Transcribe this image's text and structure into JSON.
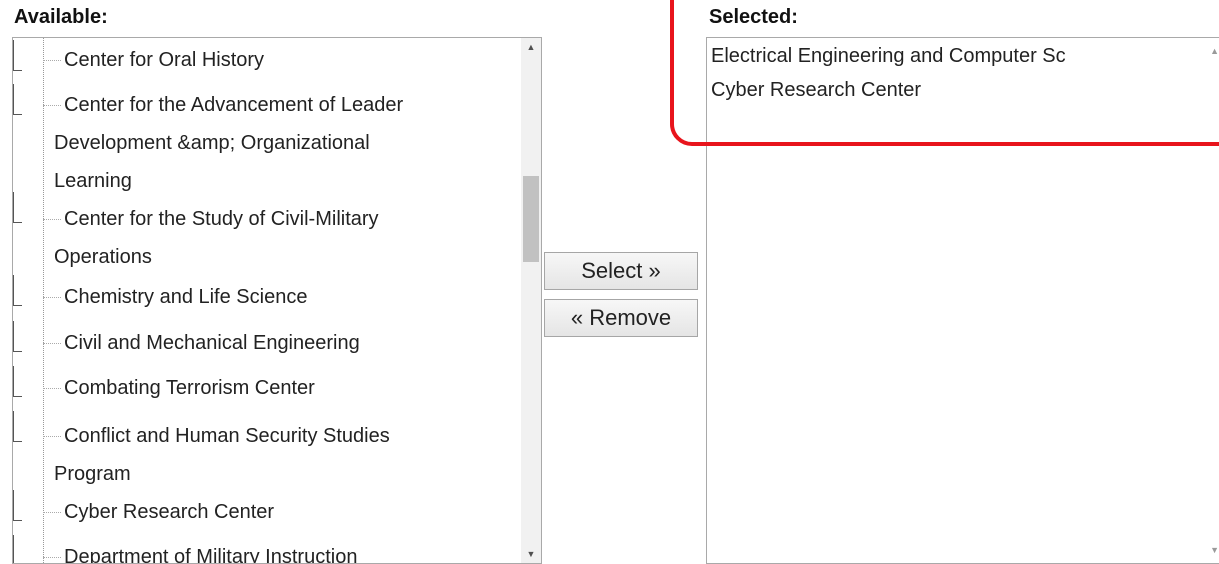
{
  "available": {
    "label": "Available:",
    "items": [
      "Center for Oral History",
      "Center for the Advancement of Leader",
      "Development &amp; Organizational",
      "Learning",
      "Center for the Study of Civil-Military",
      "Operations",
      "Chemistry and Life Science",
      "Civil and Mechanical Engineering",
      "Combating Terrorism Center",
      "Conflict and Human Security Studies",
      "Program",
      "Cyber Research Center",
      "Department of Military Instruction"
    ]
  },
  "buttons": {
    "select_label": "Select »",
    "remove_label": "« Remove"
  },
  "selected": {
    "label": "Selected:",
    "items": [
      "Electrical Engineering and Computer Sc",
      "Cyber Research Center"
    ]
  },
  "colors": {
    "highlight": "#e8141c"
  }
}
